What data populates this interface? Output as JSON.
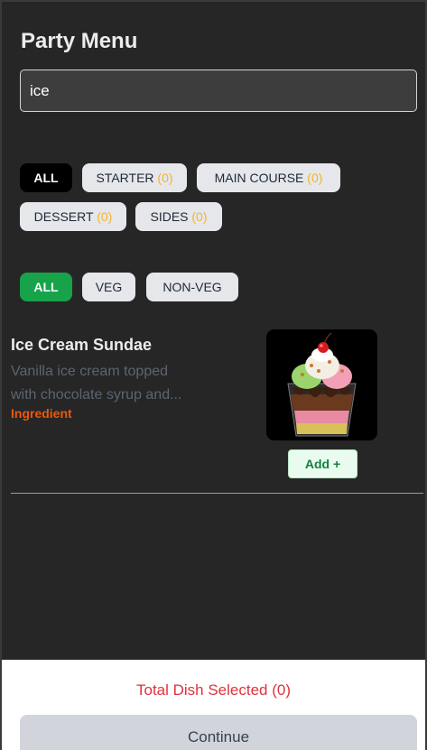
{
  "page": {
    "title": "Party Menu"
  },
  "search": {
    "value": "ice"
  },
  "course_filters": [
    {
      "label": "ALL"
    },
    {
      "label": "STARTER",
      "count": "(0)"
    },
    {
      "label": "MAIN COURSE",
      "count": "(0)"
    },
    {
      "label": "DESSERT",
      "count": "(0)"
    },
    {
      "label": "SIDES",
      "count": "(0)"
    }
  ],
  "diet_filters": [
    {
      "label": "ALL"
    },
    {
      "label": "VEG"
    },
    {
      "label": "NON-VEG"
    }
  ],
  "dishes": [
    {
      "name": "Ice Cream Sundae",
      "description": "Vanilla ice cream topped with chocolate syrup and...",
      "desc_line1": "Vanilla ice cream topped",
      "desc_line2": "with chocolate syrup and...",
      "tag": "Ingredient",
      "add_label": "Add +"
    }
  ],
  "footer": {
    "total_label": "Total Dish Selected (0)",
    "continue_label": "Continue"
  },
  "colors": {
    "background": "#262626",
    "accent_green": "#16a34a",
    "count_yellow": "#f5b52a",
    "ingredient_orange": "#ea580c",
    "total_red": "#e0323b"
  }
}
